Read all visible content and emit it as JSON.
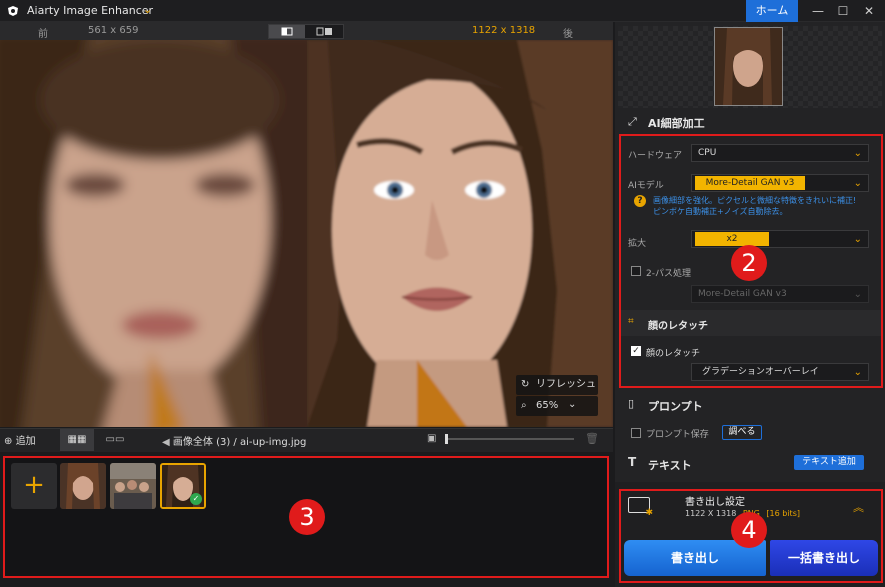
{
  "window": {
    "title": "Aiarty Image Enhancer",
    "home_label": "ホーム",
    "minimize": "—",
    "maximize": "☐",
    "close": "✕"
  },
  "compare": {
    "before_label": "前",
    "before_size": "561 x 659",
    "after_size": "1122 x 1318",
    "after_label": "後"
  },
  "overlay": {
    "refresh_label": "リフレッシュ",
    "zoom_value": "65%"
  },
  "toolbar": {
    "add_label": "追加",
    "breadcrumb_all": "画像全体 (3)",
    "breadcrumb_sep": "/",
    "breadcrumb_file": "ai-up-img.jpg"
  },
  "badges": {
    "two": "2",
    "three": "3",
    "four": "4"
  },
  "ai_detail": {
    "title": "AI細部加工",
    "hardware_label": "ハードウェア",
    "hardware_value": "CPU",
    "model_label": "AIモデル",
    "model_value": "More-Detail GAN  v3",
    "info_line1": "画像細部を強化。ピクセルと微細な特徴をきれいに補正!",
    "info_line2": "ピンボケ自動補正+ノイズ自動除去。",
    "scale_label": "拡大",
    "scale_value": "x2",
    "two_pass_label": "2-パス処理",
    "two_pass_model": "More-Detail GAN  v3"
  },
  "face": {
    "title": "顔のレタッチ",
    "checkbox_label": "顔のレタッチ",
    "mode_value": "グラデーションオーバーレイ"
  },
  "prompt": {
    "title": "プロンプト",
    "save_label": "プロンプト保存",
    "lookup_label": "調べる"
  },
  "text_section": {
    "title": "テキスト",
    "add_label": "テキスト追加"
  },
  "export": {
    "title": "書き出し設定",
    "size": "1122 X 1318",
    "format": "PNG",
    "bits": "[16 bits]",
    "export_label": "書き出し",
    "batch_label": "一括書き出し"
  },
  "colors": {
    "accent": "#e8a400",
    "primary": "#1e6fd9",
    "highlight": "#e01b1b"
  }
}
